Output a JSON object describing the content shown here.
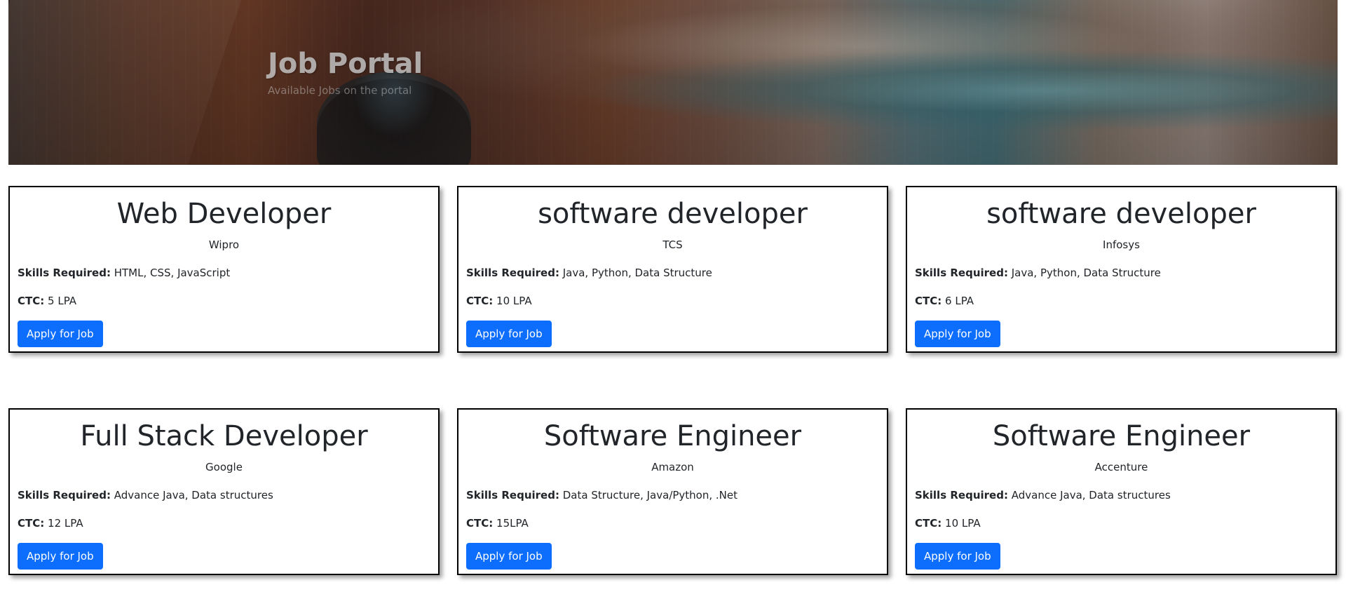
{
  "hero": {
    "title": "Job Portal",
    "subtitle": "Available Jobs on the portal"
  },
  "labels": {
    "skills": "Skills Required:",
    "ctc": "CTC:",
    "apply": "Apply for Job"
  },
  "jobs": [
    {
      "title": "Web Developer",
      "company": "Wipro",
      "skills": "HTML, CSS, JavaScript",
      "ctc": "5 LPA"
    },
    {
      "title": "software developer",
      "company": "TCS",
      "skills": "Java, Python, Data Structure",
      "ctc": "10 LPA"
    },
    {
      "title": "software developer",
      "company": "Infosys",
      "skills": "Java, Python, Data Structure",
      "ctc": "6 LPA"
    },
    {
      "title": "Full Stack Developer",
      "company": "Google",
      "skills": "Advance Java, Data structures",
      "ctc": "12 LPA"
    },
    {
      "title": "Software Engineer",
      "company": "Amazon",
      "skills": "Data Structure, Java/Python, .Net",
      "ctc": "15LPA"
    },
    {
      "title": "Software Engineer",
      "company": "Accenture",
      "skills": "Advance Java, Data structures",
      "ctc": "10 LPA"
    }
  ],
  "colors": {
    "button": "#0d6efd",
    "card_border": "#000000"
  }
}
